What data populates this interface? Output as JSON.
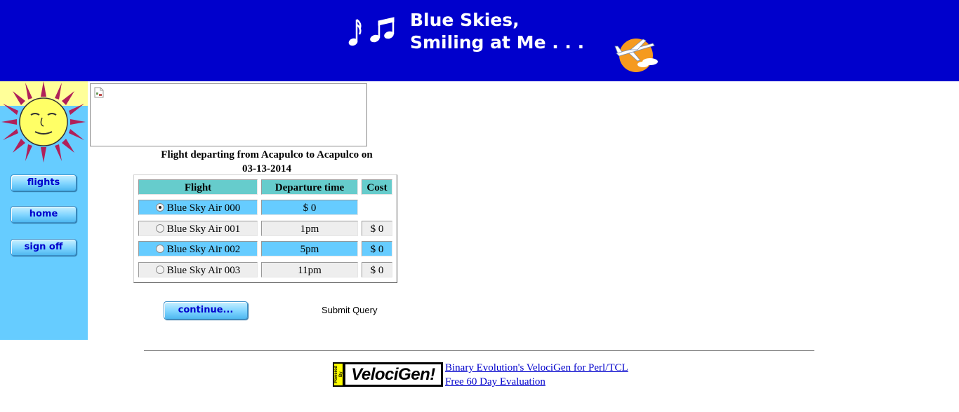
{
  "banner": {
    "title_line1": "Blue Skies,",
    "title_line2": "Smiling at Me . . .",
    "decor_icon": "music-notes-icon",
    "logo_icon": "airplane-sunset-logo"
  },
  "sidebar": {
    "logo_icon": "sun-face-logo",
    "nav": [
      {
        "label": "flights"
      },
      {
        "label": "home"
      },
      {
        "label": "sign off"
      }
    ]
  },
  "ad_frame": {
    "icon": "broken-image-icon"
  },
  "results": {
    "title_line1": "Flight departing from Acapulco to Acapulco on",
    "title_line2": "03-13-2014",
    "columns": [
      "Flight",
      "Departure time",
      "Cost"
    ],
    "rows": [
      {
        "flight": "Blue Sky Air 000",
        "departure": "$ 0",
        "cost": "",
        "selected": true
      },
      {
        "flight": "Blue Sky Air 001",
        "departure": "1pm",
        "cost": "$ 0",
        "selected": false
      },
      {
        "flight": "Blue Sky Air 002",
        "departure": "5pm",
        "cost": "$ 0",
        "selected": false
      },
      {
        "flight": "Blue Sky Air 003",
        "departure": "11pm",
        "cost": "$ 0",
        "selected": false
      }
    ]
  },
  "actions": {
    "continue_label": "continue...",
    "submit_label": "Submit Query"
  },
  "footer": {
    "badge_powered": "Powered By",
    "badge_brand": "VelociGen!",
    "link1": "Binary Evolution's VelociGen for Perl/TCL",
    "link2": "Free 60 Day Evaluation"
  },
  "colors": {
    "banner_bg": "#0000cc",
    "sidebar_bg": "#66ccff",
    "header_cell": "#66cccc",
    "row_blue": "#66ccff",
    "row_gray": "#eeeeee"
  }
}
